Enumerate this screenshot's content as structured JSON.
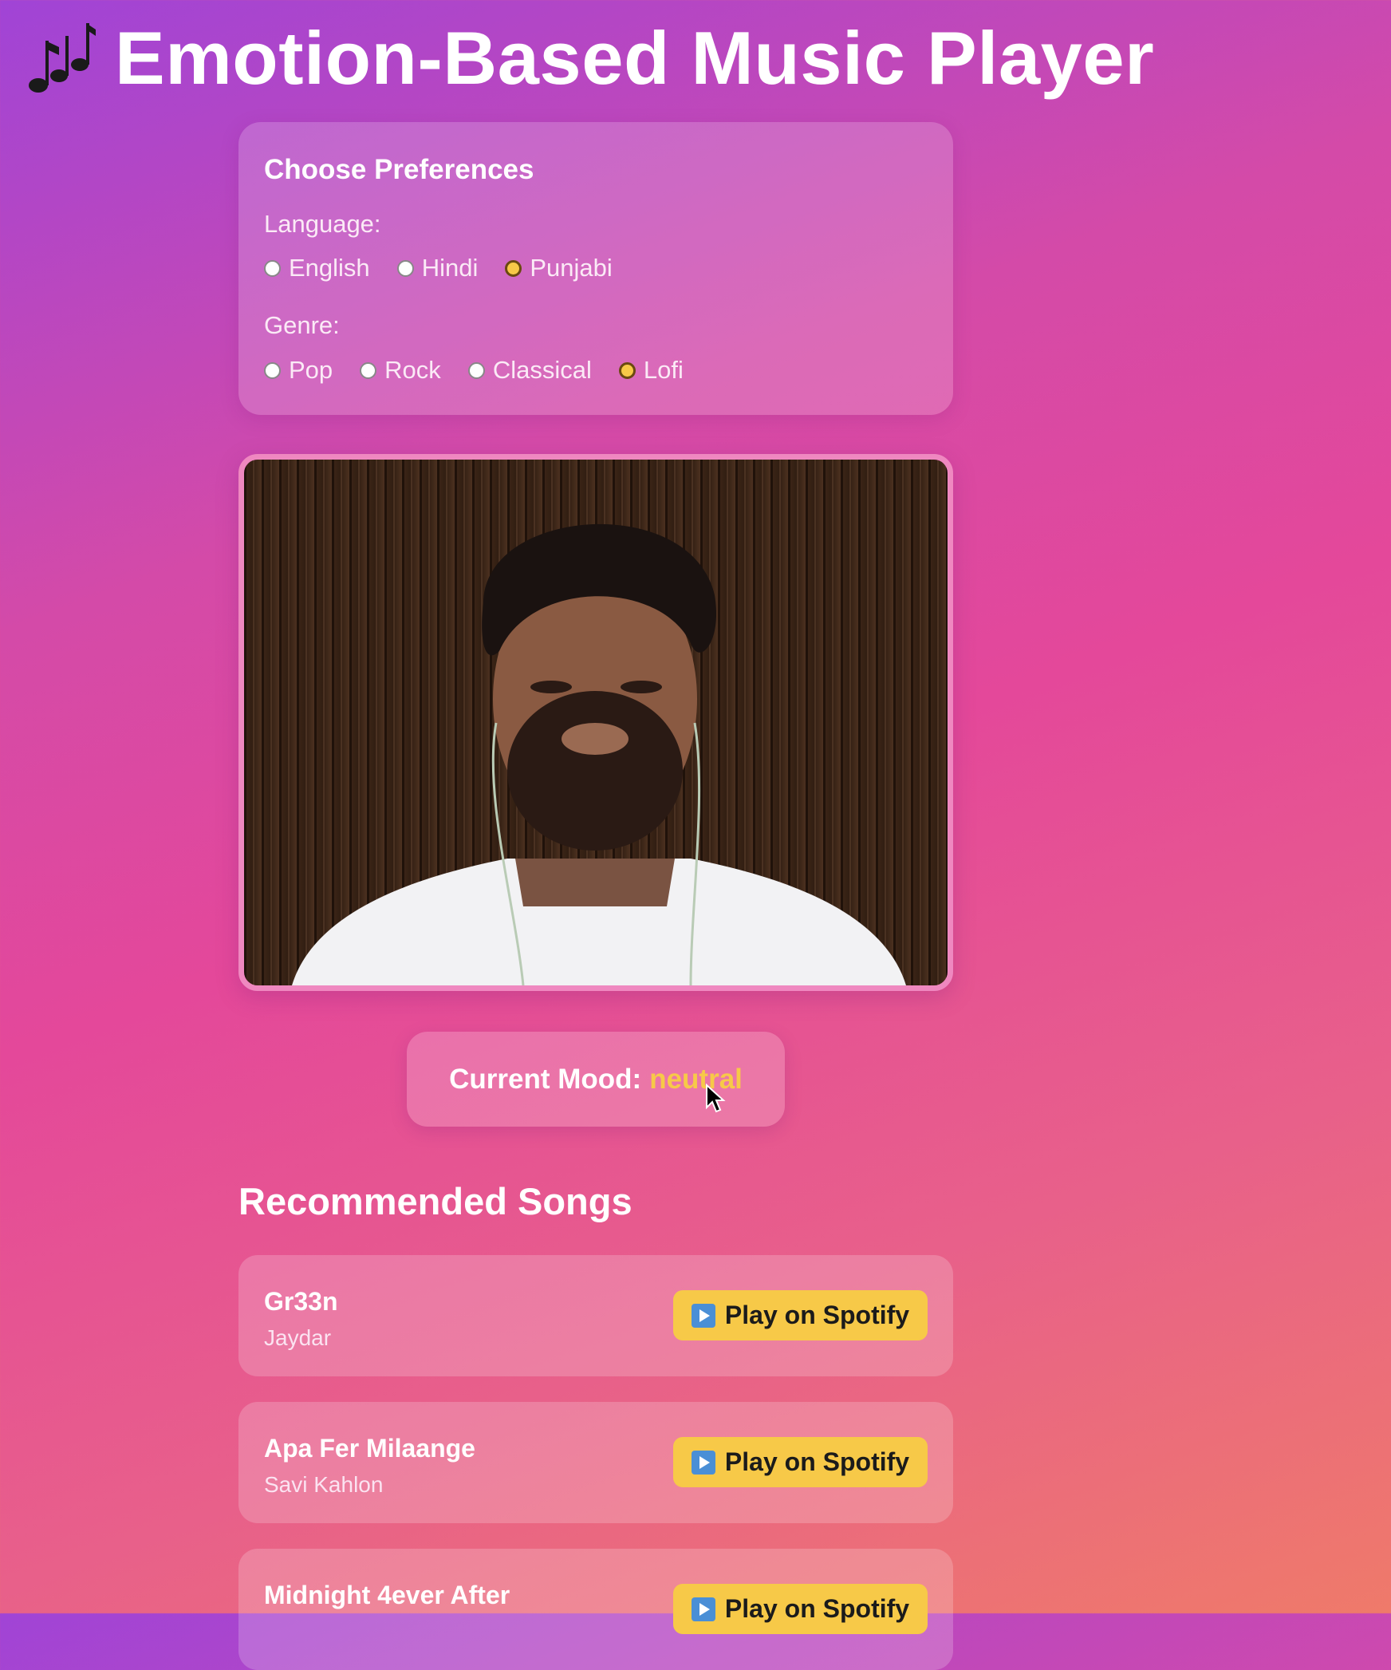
{
  "header": {
    "title": "Emotion-Based Music Player",
    "icon": "musical-notes-icon"
  },
  "preferences": {
    "title": "Choose Preferences",
    "language_label": "Language:",
    "languages": [
      "English",
      "Hindi",
      "Punjabi"
    ],
    "selected_language": "Punjabi",
    "genre_label": "Genre:",
    "genres": [
      "Pop",
      "Rock",
      "Classical",
      "Lofi"
    ],
    "selected_genre": "Lofi"
  },
  "mood": {
    "label": "Current Mood:",
    "value": "neutral"
  },
  "recommendations": {
    "title": "Recommended Songs",
    "button_label": "Play on Spotify",
    "songs": [
      {
        "title": "Gr33n",
        "artist": "Jaydar"
      },
      {
        "title": "Apa Fer Milaange",
        "artist": "Savi Kahlon"
      },
      {
        "title": "Midnight 4ever After",
        "artist": ""
      }
    ]
  },
  "colors": {
    "accent": "#f7c948",
    "gradient_start": "#a044d6",
    "gradient_end": "#ef7a6a"
  }
}
